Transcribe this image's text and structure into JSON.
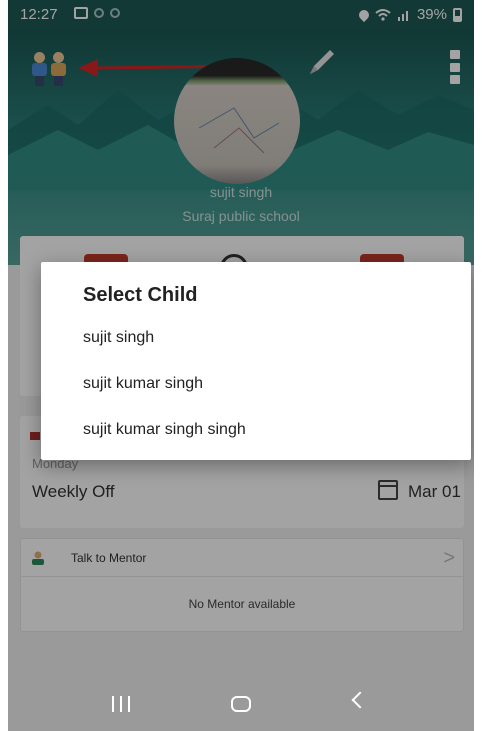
{
  "status_bar": {
    "time": "12:27",
    "battery": "39%"
  },
  "profile": {
    "student_name": "sujit singh",
    "school_name": "Suraj public school"
  },
  "dialog": {
    "title": "Select Child",
    "options": [
      "sujit singh",
      "sujit kumar singh",
      "sujit kumar singh singh"
    ]
  },
  "day_card": {
    "day_label": "Monday",
    "status": "Weekly Off",
    "date": "Mar 01"
  },
  "mentor": {
    "title": "Talk to Mentor",
    "empty_text": "No Mentor available"
  },
  "colors": {
    "header": "#1b5753",
    "accent_red": "#d62828",
    "scrim": "rgba(0,0,0,0.36)"
  },
  "icons": [
    "children-icon",
    "edit-icon",
    "overflow-menu-icon",
    "calendar-icon",
    "person-icon",
    "chevron-right-icon"
  ]
}
